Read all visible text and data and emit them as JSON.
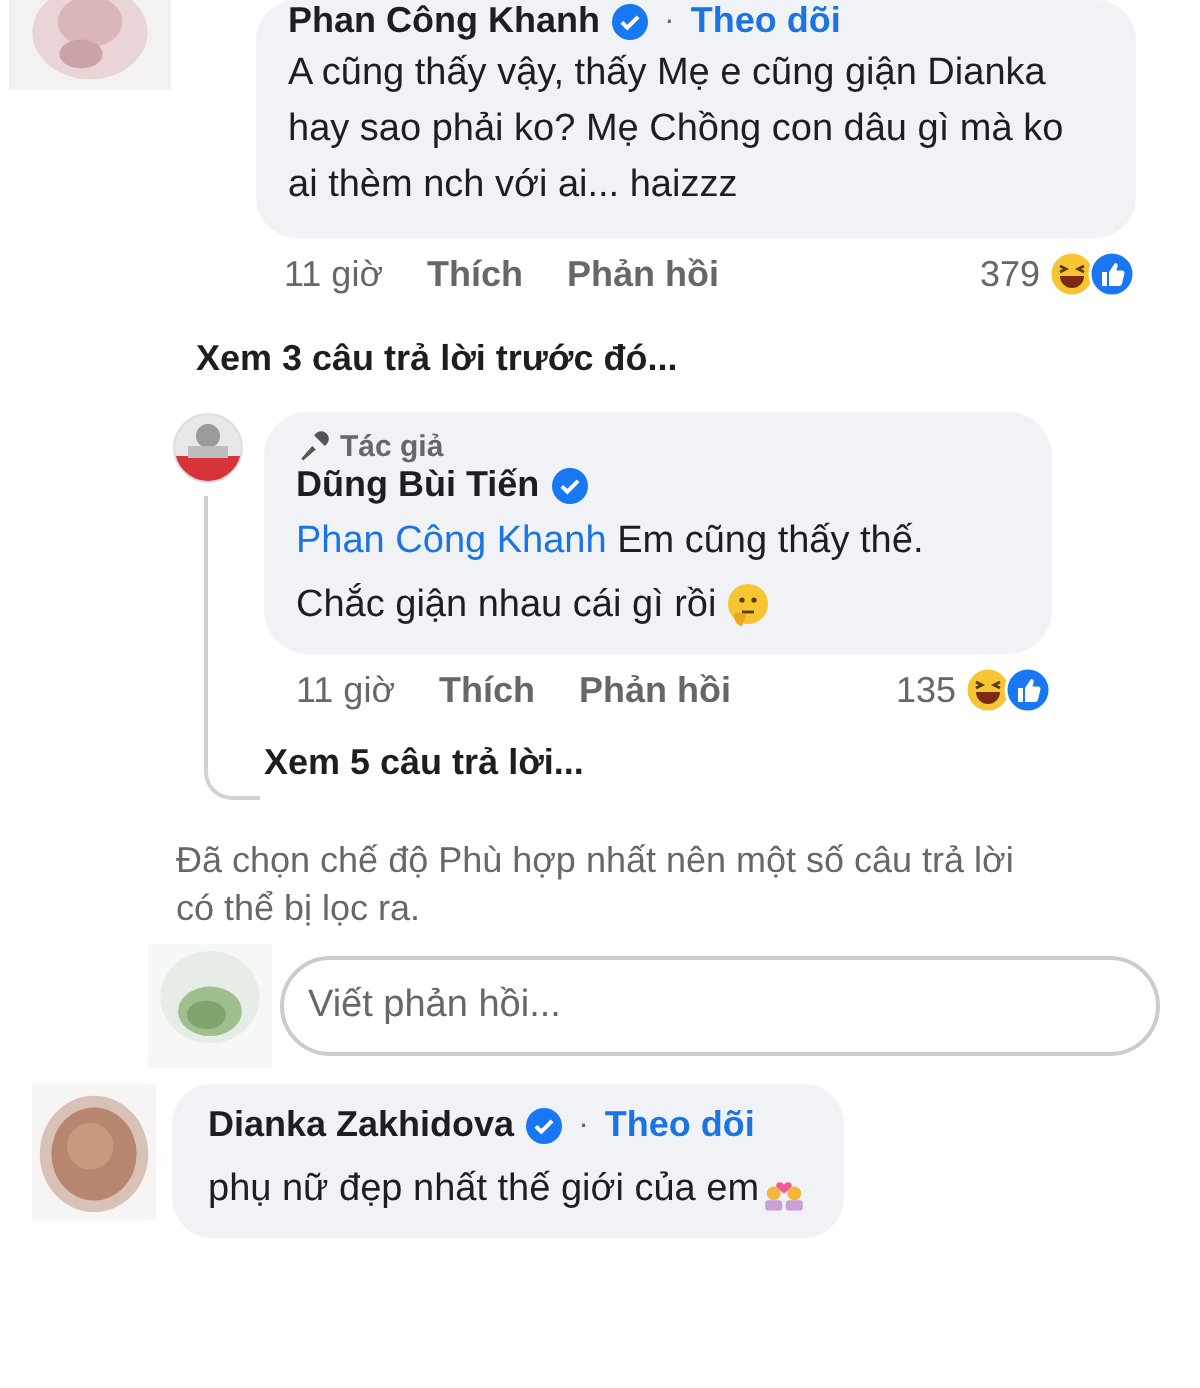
{
  "comment_top": {
    "author": "Phan Công Khanh",
    "verified": true,
    "separator": "·",
    "follow": "Theo dõi",
    "lines": [
      "A cũng thấy vậy, thấy Mẹ e cũng giận Dianka",
      "hay sao phải ko? Mẹ Chồng con dâu gì mà ko",
      "ai thèm nch với ai... haizzz"
    ],
    "time": "11 giờ",
    "like": "Thích",
    "reply": "Phản hồi",
    "reaction_count": "379"
  },
  "view_previous": "Xem 3 câu trả lời trước đó...",
  "reply": {
    "badge": "Tác giả",
    "author": "Dũng Bùi Tiến",
    "verified": true,
    "mention": "Phan Công Khanh",
    "first_line": "Em cũng thấy thế.",
    "second_line": "Chắc giận nhau cái gì rồi",
    "time": "11 giờ",
    "like": "Thích",
    "reply": "Phản hồi",
    "reaction_count": "135"
  },
  "view_replies": "Xem 5 câu trả lời...",
  "filter_notice": "Đã chọn chế độ Phù hợp nhất nên một số câu trả lời có thể bị lọc ra.",
  "reply_field": {
    "placeholder": "Viết phản hồi..."
  },
  "comment_bottom": {
    "author": "Dianka Zakhidova",
    "verified": true,
    "separator": "·",
    "follow": "Theo dõi",
    "text": "phụ nữ đẹp nhất thế giới của em"
  }
}
